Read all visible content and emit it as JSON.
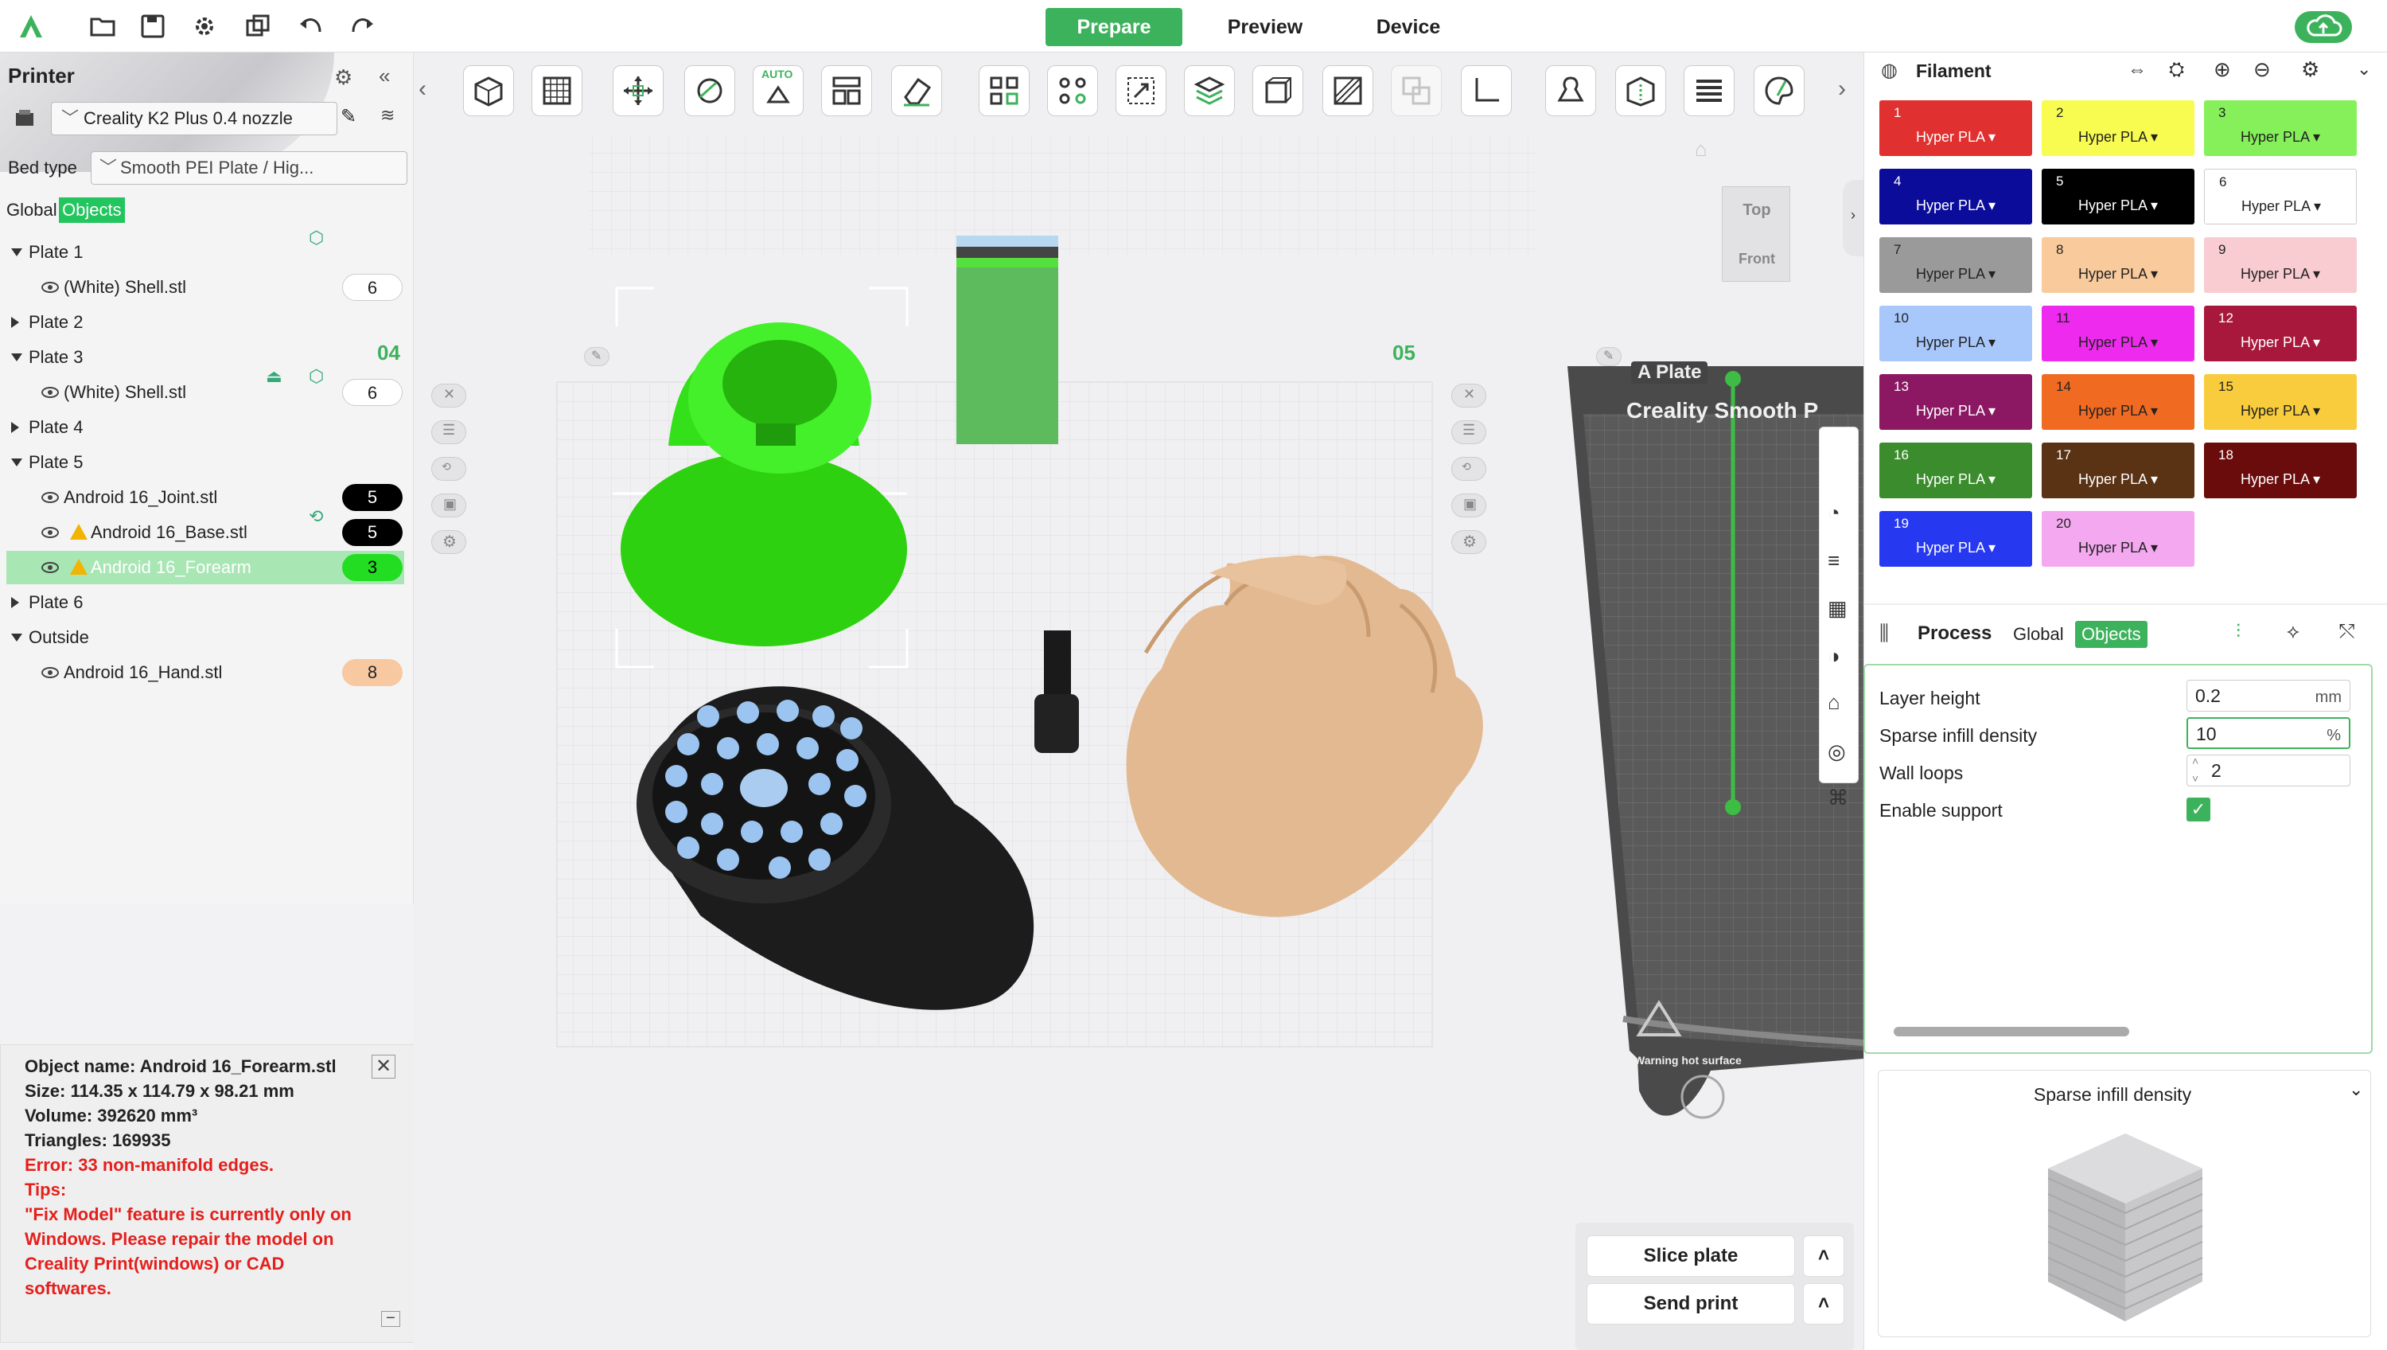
{
  "topbar": {
    "tabs": [
      "Prepare",
      "Preview",
      "Device"
    ],
    "colors": {
      "accent": "#3db25c",
      "upload": "#3db25c"
    }
  },
  "left": {
    "printer_title": "Printer",
    "printer_name": "Creality K2 Plus 0.4 nozzle",
    "bed_type_label": "Bed type",
    "bed_type_value": "Smooth PEI Plate / Hig...",
    "view_tabs": [
      "Global",
      "Objects"
    ],
    "tree": [
      {
        "label": "Plate 1",
        "kind": "plate",
        "expanded": true
      },
      {
        "label": "(White) Shell.stl",
        "kind": "object",
        "badge": "6",
        "badge_color": "#ffffff",
        "badge_text": "#222222"
      },
      {
        "label": "Plate 2",
        "kind": "plate",
        "expanded": false
      },
      {
        "label": "Plate 3",
        "kind": "plate",
        "expanded": true
      },
      {
        "label": "(White) Shell.stl",
        "kind": "object",
        "badge": "6",
        "badge_color": "#ffffff",
        "badge_text": "#222222"
      },
      {
        "label": "Plate 4",
        "kind": "plate",
        "expanded": false
      },
      {
        "label": "Plate 5",
        "kind": "plate",
        "expanded": true
      },
      {
        "label": "Android 16_Joint.stl",
        "kind": "object",
        "badge": "5",
        "badge_color": "#000000",
        "badge_text": "#ffffff"
      },
      {
        "label": "Android 16_Base.stl",
        "kind": "object",
        "warning": true,
        "badge": "5",
        "badge_color": "#000000",
        "badge_text": "#ffffff"
      },
      {
        "label": "Android 16_Forearm",
        "kind": "object",
        "warning": true,
        "selected": true,
        "badge": "3",
        "badge_color": "#22dd22",
        "badge_text": "#000000"
      },
      {
        "label": "Plate 6",
        "kind": "plate",
        "expanded": false
      },
      {
        "label": "Outside",
        "kind": "plate",
        "expanded": true
      },
      {
        "label": "Android 16_Hand.stl",
        "kind": "object",
        "badge": "8",
        "badge_color": "#f8c8a0",
        "badge_text": "#222222"
      }
    ]
  },
  "info": {
    "name": "Object name: Android 16_Forearm.stl",
    "size": "Size: 114.35 x 114.79 x 98.21 mm",
    "volume": "Volume: 392620 mm³",
    "triangles": "Triangles: 169935",
    "error": "Error: 33 non-manifold edges.",
    "tips_label": "Tips:",
    "tips_lines": [
      "\"Fix Model\" feature is currently only on",
      "Windows. Please repair the model on",
      "Creality Print(windows) or CAD",
      "softwares."
    ]
  },
  "viewport": {
    "plate_number_left": "04",
    "plate_number_right": "05",
    "auto_label": "AUTO",
    "view_top": "Top",
    "view_front": "Front",
    "plate_label": "A Plate",
    "bed_brand": "Creality Smooth P",
    "bed_warning": "Warning hot surface",
    "slice_button": "Slice plate",
    "send_button": "Send print"
  },
  "filament": {
    "title": "Filament",
    "items": [
      {
        "num": "1",
        "type": "Hyper PLA",
        "color": "#e03030",
        "text": "#ffffff"
      },
      {
        "num": "2",
        "type": "Hyper PLA",
        "color": "#f8fc50",
        "text": "#222222"
      },
      {
        "num": "3",
        "type": "Hyper PLA",
        "color": "#86f05a",
        "text": "#222222"
      },
      {
        "num": "4",
        "type": "Hyper PLA",
        "color": "#0c0c9a",
        "text": "#ffffff"
      },
      {
        "num": "5",
        "type": "Hyper PLA",
        "color": "#000000",
        "text": "#ffffff"
      },
      {
        "num": "6",
        "type": "Hyper PLA",
        "color": "#ffffff",
        "text": "#222222"
      },
      {
        "num": "7",
        "type": "Hyper PLA",
        "color": "#9a9a9a",
        "text": "#222222"
      },
      {
        "num": "8",
        "type": "Hyper PLA",
        "color": "#f8ca9c",
        "text": "#222222"
      },
      {
        "num": "9",
        "type": "Hyper PLA",
        "color": "#f8ccd0",
        "text": "#222222"
      },
      {
        "num": "10",
        "type": "Hyper PLA",
        "color": "#a8c8fc",
        "text": "#222222"
      },
      {
        "num": "11",
        "type": "Hyper PLA",
        "color": "#ee2aee",
        "text": "#222222"
      },
      {
        "num": "12",
        "type": "Hyper PLA",
        "color": "#a8183c",
        "text": "#ffffff"
      },
      {
        "num": "13",
        "type": "Hyper PLA",
        "color": "#8c1864",
        "text": "#ffffff"
      },
      {
        "num": "14",
        "type": "Hyper PLA",
        "color": "#f06a22",
        "text": "#222222"
      },
      {
        "num": "15",
        "type": "Hyper PLA",
        "color": "#f8cc3c",
        "text": "#222222"
      },
      {
        "num": "16",
        "type": "Hyper PLA",
        "color": "#3a8c2c",
        "text": "#ffffff"
      },
      {
        "num": "17",
        "type": "Hyper PLA",
        "color": "#5a3214",
        "text": "#ffffff"
      },
      {
        "num": "18",
        "type": "Hyper PLA",
        "color": "#6a0c0c",
        "text": "#ffffff"
      },
      {
        "num": "19",
        "type": "Hyper PLA",
        "color": "#2638f0",
        "text": "#ffffff"
      },
      {
        "num": "20",
        "type": "Hyper PLA",
        "color": "#f4a8f0",
        "text": "#222222"
      }
    ]
  },
  "process": {
    "title": "Process",
    "tabs": [
      "Global",
      "Objects"
    ],
    "layer_height_label": "Layer height",
    "layer_height_value": "0.2",
    "layer_height_unit": "mm",
    "infill_label": "Sparse infill density",
    "infill_value": "10",
    "infill_unit": "%",
    "wall_loops_label": "Wall loops",
    "wall_loops_value": "2",
    "support_label": "Enable support",
    "support_checked": true
  },
  "preview_panel": {
    "title": "Sparse infill density"
  }
}
